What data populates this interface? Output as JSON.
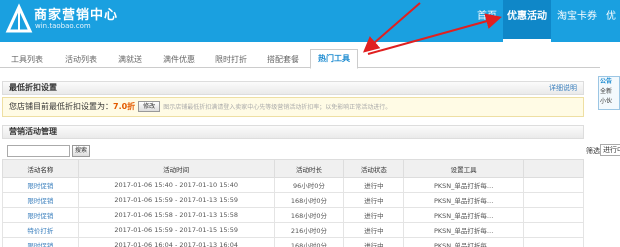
{
  "header": {
    "title": "商家营销中心",
    "subtitle": "win.taobao.com",
    "nav": [
      "首页",
      "优惠活动",
      "淘宝卡券",
      "优"
    ]
  },
  "tabs": [
    "工具列表",
    "活动列表",
    "满就送",
    "满件优惠",
    "限时打折",
    "搭配套餐",
    "热门工具"
  ],
  "min_discount": {
    "title": "最低折扣设置",
    "help": "详细说明",
    "prefix": "您店铺目前最低折扣设置为：",
    "value": "7.0折",
    "button": "修改",
    "hint": "图示店铺最低折扣满请登入卖家中心先等级营销活动折扣率；以免影响正常活动进行。"
  },
  "side_notice": {
    "title": "公告",
    "line1": "全新",
    "line2": "小伙"
  },
  "management": {
    "title": "营销活动管理",
    "search_button": "搜索",
    "filter_label": "筛选",
    "filter_value": "进行中"
  },
  "table": {
    "headers": [
      "活动名称",
      "活动时间",
      "活动时长",
      "活动状态",
      "设置工具",
      ""
    ],
    "rows": [
      [
        "限时促销",
        "2017-01-06 15:40 - 2017-01-10 15:40",
        "96小时0分",
        "进行中",
        "PKSN_单品打折每…",
        ""
      ],
      [
        "限时促销",
        "2017-01-06 15:59 - 2017-01-13 15:59",
        "168小时0分",
        "进行中",
        "PKSN_单品打折每…",
        ""
      ],
      [
        "限时促销",
        "2017-01-06 15:58 - 2017-01-13 15:58",
        "168小时0分",
        "进行中",
        "PKSN_单品打折每…",
        ""
      ],
      [
        "特价打折",
        "2017-01-06 15:59 - 2017-01-15 15:59",
        "216小时0分",
        "进行中",
        "PKSN_单品打折每…",
        ""
      ],
      [
        "限时促销",
        "2017-01-06 16:04 - 2017-01-13 16:04",
        "168小时0分",
        "进行中",
        "PKSN_单品打折每…",
        ""
      ]
    ]
  },
  "colors": {
    "header_bg": "#1aa0e0",
    "accent_red": "#e02020",
    "discount": "#e35a00"
  }
}
